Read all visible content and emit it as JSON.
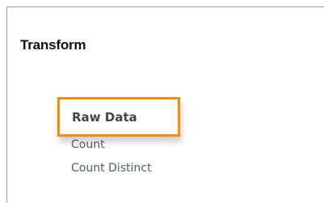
{
  "panel": {
    "title": "Transform"
  },
  "options": {
    "raw_data": "Raw Data",
    "count": "Count",
    "count_distinct": "Count Distinct"
  },
  "colors": {
    "highlight": "#ff8a00",
    "option_text": "#4b5f6e",
    "selected_text": "#444444"
  }
}
